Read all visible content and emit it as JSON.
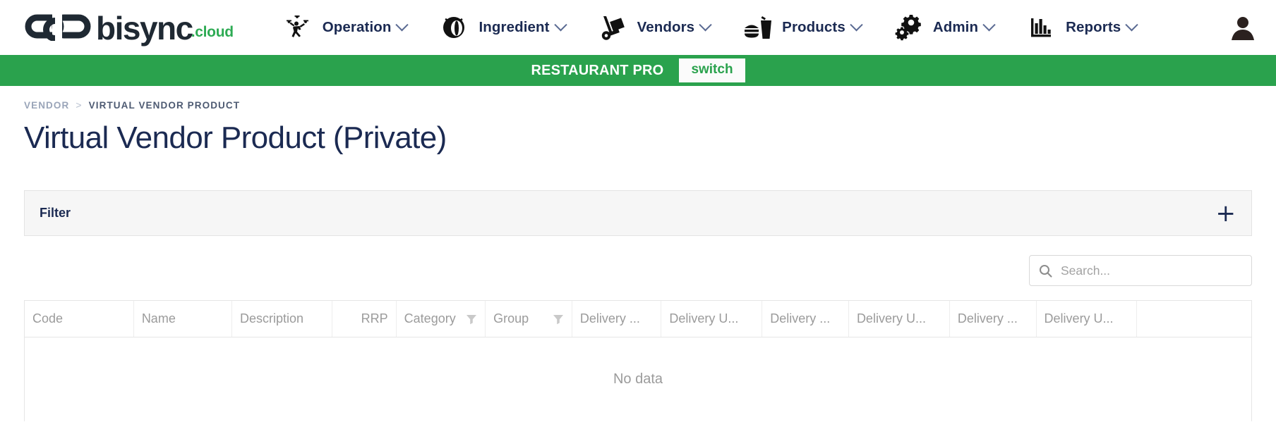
{
  "brand": {
    "name": "bisync",
    "suffix": ".cloud",
    "logo_icon": "chain-link-icon",
    "green": "#2aa24d",
    "navy": "#1b2a52"
  },
  "nav": {
    "items": [
      {
        "label": "Operation",
        "icon": "juggler-icon",
        "caret": "chevron-down-icon"
      },
      {
        "label": "Ingredient",
        "icon": "coconut-icon",
        "caret": "chevron-down-icon"
      },
      {
        "label": "Vendors",
        "icon": "hand-truck-icon",
        "caret": "chevron-down-icon"
      },
      {
        "label": "Products",
        "icon": "burger-drink-icon",
        "caret": "chevron-down-icon"
      },
      {
        "label": "Admin",
        "icon": "gears-icon",
        "caret": "chevron-down-icon"
      },
      {
        "label": "Reports",
        "icon": "bar-chart-icon",
        "caret": "chevron-down-icon"
      }
    ],
    "account_icon": "user-avatar-icon"
  },
  "banner": {
    "title": "RESTAURANT PRO",
    "switch_label": "switch"
  },
  "breadcrumb": {
    "parent": "VENDOR",
    "separator": ">",
    "current": "VIRTUAL VENDOR PRODUCT"
  },
  "page": {
    "title": "Virtual Vendor Product (Private)"
  },
  "filter": {
    "label": "Filter",
    "expand_icon": "plus-icon",
    "expand_glyph": "+"
  },
  "search": {
    "placeholder": "Search...",
    "value": "",
    "icon": "search-icon"
  },
  "table": {
    "columns": [
      {
        "label": "Code",
        "align": "left",
        "filter": false
      },
      {
        "label": "Name",
        "align": "left",
        "filter": false
      },
      {
        "label": "Description",
        "align": "left",
        "filter": false
      },
      {
        "label": "RRP",
        "align": "right",
        "filter": false
      },
      {
        "label": "Category",
        "align": "left",
        "filter": true
      },
      {
        "label": "Group",
        "align": "left",
        "filter": true
      },
      {
        "label": "Delivery ...",
        "align": "left",
        "filter": false
      },
      {
        "label": "Delivery U...",
        "align": "left",
        "filter": false
      },
      {
        "label": "Delivery ...",
        "align": "left",
        "filter": false
      },
      {
        "label": "Delivery U...",
        "align": "left",
        "filter": false
      },
      {
        "label": "Delivery ...",
        "align": "left",
        "filter": false
      },
      {
        "label": "Delivery U...",
        "align": "left",
        "filter": false
      },
      {
        "label": "",
        "align": "left",
        "filter": false
      }
    ],
    "rows": [],
    "empty_text": "No data"
  }
}
